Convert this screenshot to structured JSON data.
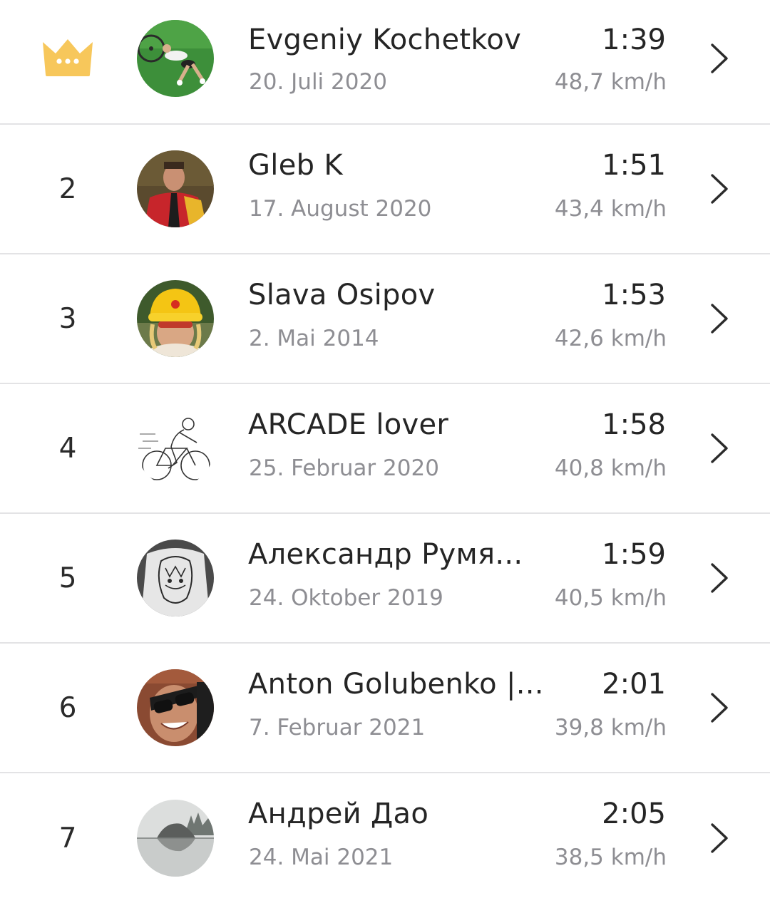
{
  "leaderboard": {
    "rows": [
      {
        "rank": "",
        "rank_icon": "crown-icon",
        "avatar": "avatar-cyclist-lying-on-grass",
        "name": "Evgeniy Kochetkov",
        "date": "20. Juli 2020",
        "time": "1:39",
        "speed": "48,7 km/h"
      },
      {
        "rank": "2",
        "avatar": "avatar-man-red-jacket",
        "name": "Gleb K",
        "date": "17. August 2020",
        "time": "1:51",
        "speed": "43,4 km/h"
      },
      {
        "rank": "3",
        "avatar": "avatar-man-yellow-hat",
        "name": "Slava Osipov",
        "date": "2. Mai 2014",
        "time": "1:53",
        "speed": "42,6 km/h"
      },
      {
        "rank": "4",
        "avatar": "avatar-cyclist-sketch",
        "name": "ARCADE lover",
        "date": "25. Februar 2020",
        "time": "1:58",
        "speed": "40,8 km/h"
      },
      {
        "rank": "5",
        "avatar": "avatar-sketch-shirt",
        "name": "Александр Румя...",
        "date": "24. Oktober 2019",
        "time": "1:59",
        "speed": "40,5 km/h"
      },
      {
        "rank": "6",
        "avatar": "avatar-man-sunglasses",
        "name": "Anton Golubenko |...",
        "date": "7. Februar 2021",
        "time": "2:01",
        "speed": "39,8 km/h"
      },
      {
        "rank": "7",
        "avatar": "avatar-lake-rock",
        "name": "Андрей Дао",
        "date": "24. Mai 2021",
        "time": "2:05",
        "speed": "38,5 km/h"
      }
    ]
  },
  "colors": {
    "crown": "#f7c75b",
    "separator": "#e3e3e5",
    "primary_text": "#252525",
    "secondary_text": "#8e8e93"
  }
}
